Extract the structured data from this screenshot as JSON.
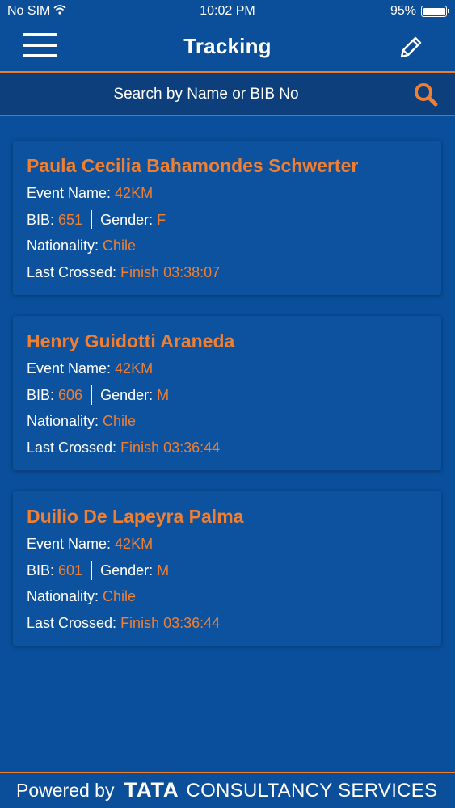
{
  "status_bar": {
    "carrier": "No SIM",
    "time": "10:02 PM",
    "battery": "95%"
  },
  "header": {
    "title": "Tracking",
    "menu_icon": "hamburger-menu-icon",
    "edit_icon": "pencil-icon"
  },
  "search": {
    "placeholder": "Search by Name or BIB No",
    "value": "",
    "icon": "search-icon"
  },
  "labels": {
    "event_name": "Event Name:",
    "bib": "BIB:",
    "gender": "Gender:",
    "nationality": "Nationality:",
    "last_crossed": "Last Crossed:"
  },
  "participants": [
    {
      "name": "Paula Cecilia Bahamondes Schwerter",
      "event_name": "42KM",
      "bib": "651",
      "gender": "F",
      "nationality": "Chile",
      "last_crossed": "Finish 03:38:07"
    },
    {
      "name": "Henry Guidotti Araneda",
      "event_name": "42KM",
      "bib": "606",
      "gender": "M",
      "nationality": "Chile",
      "last_crossed": "Finish 03:36:44"
    },
    {
      "name": "Duilio De Lapeyra Palma",
      "event_name": "42KM",
      "bib": "601",
      "gender": "M",
      "nationality": "Chile",
      "last_crossed": "Finish 03:36:44"
    }
  ],
  "footer": {
    "powered_by": "Powered by",
    "brand": "TATA",
    "company": "CONSULTANCY SERVICES"
  },
  "colors": {
    "background": "#0a4f9c",
    "accent": "#f07f32",
    "text": "#ffffff"
  }
}
